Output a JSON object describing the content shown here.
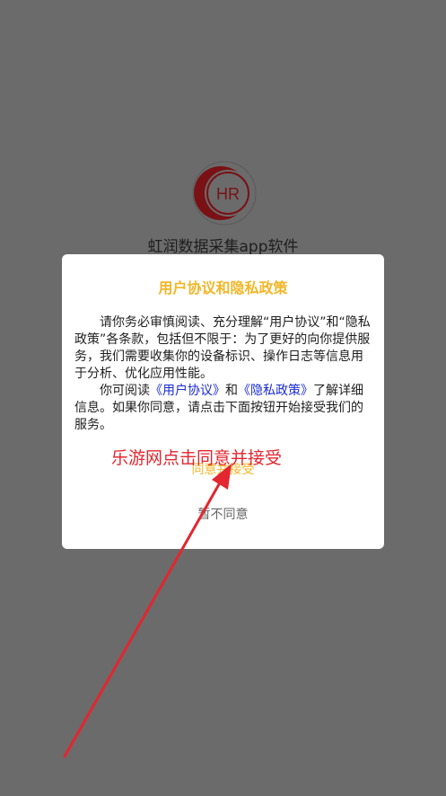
{
  "splash": {
    "logo_text": "HR",
    "app_name": "虹润数据采集app软件"
  },
  "dialog": {
    "title": "用户协议和隐私政策",
    "para1": "请你务必审慎阅读、充分理解“用户协议”和“隐私政策”各条款，包括但不限于：为了更好的向你提供服务，我们需要收集你的设备标识、操作日志等信息用于分析、优化应用性能。",
    "para2_before": "你可阅读",
    "user_agreement_link": "《用户协议》",
    "para2_and": "和",
    "privacy_policy_link": "《隐私政策》",
    "para2_after": "了解详细信息。如果你同意，请点击下面按钮开始接受我们的服务。",
    "agree_label": "同意并接受",
    "disagree_label": "暂不同意"
  },
  "annotation": {
    "text": "乐游网点击同意并接受",
    "color": "#e3262f"
  },
  "colors": {
    "overlay": "#6b6b6b",
    "accent": "#f2b628",
    "link": "#1a2bd1",
    "logo_red": "#9a1c20"
  }
}
